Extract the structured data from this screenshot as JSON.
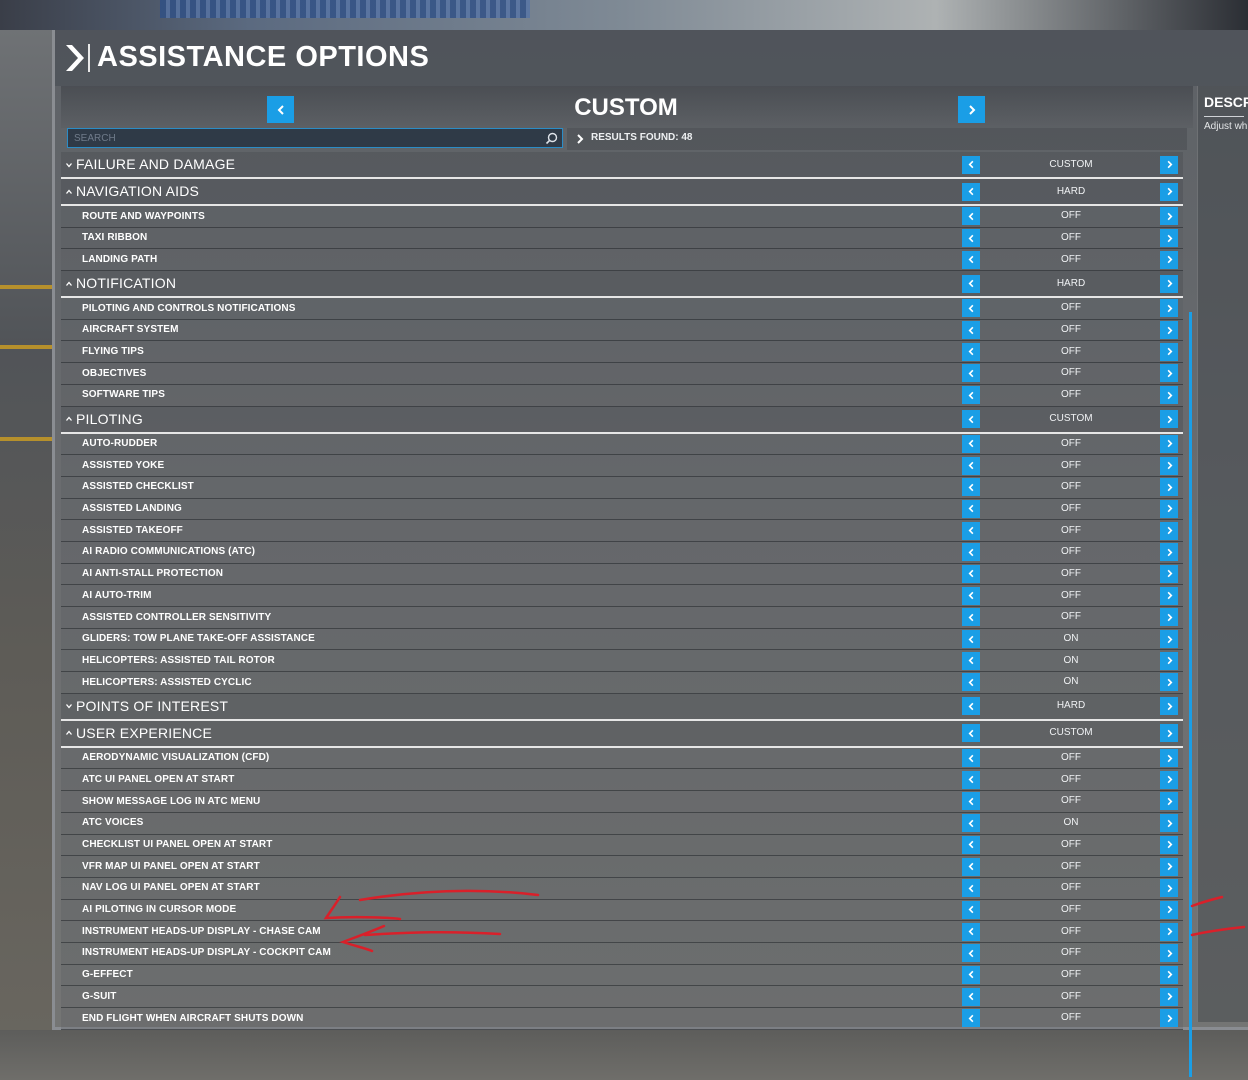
{
  "window": {
    "title": "ASSISTANCE OPTIONS"
  },
  "preset": {
    "label": "CUSTOM"
  },
  "search": {
    "placeholder": "SEARCH",
    "value": ""
  },
  "results": {
    "label": "RESULTS FOUND: 48"
  },
  "description": {
    "title": "DESCR",
    "text": "Adjust wh"
  },
  "colors": {
    "accent": "#1a9ee6",
    "annotation": "#d9202a"
  },
  "icons": {
    "header": "chevron-right-icon",
    "search": "magnifier-icon",
    "prev": "chevron-left-icon",
    "next": "chevron-right-icon",
    "expand": "caret-down-icon",
    "collapse": "caret-up-icon"
  },
  "rows": [
    {
      "kind": "cat",
      "expanded": false,
      "label": "FAILURE AND DAMAGE",
      "value": "CUSTOM"
    },
    {
      "kind": "cat",
      "expanded": true,
      "label": "NAVIGATION AIDS",
      "value": "HARD"
    },
    {
      "kind": "sub",
      "label": "ROUTE AND WAYPOINTS",
      "value": "OFF"
    },
    {
      "kind": "sub",
      "label": "TAXI RIBBON",
      "value": "OFF"
    },
    {
      "kind": "sub",
      "label": "LANDING PATH",
      "value": "OFF"
    },
    {
      "kind": "cat",
      "expanded": true,
      "label": "NOTIFICATION",
      "value": "HARD"
    },
    {
      "kind": "sub",
      "label": "PILOTING AND CONTROLS NOTIFICATIONS",
      "value": "OFF"
    },
    {
      "kind": "sub",
      "label": "AIRCRAFT SYSTEM",
      "value": "OFF"
    },
    {
      "kind": "sub",
      "label": "FLYING TIPS",
      "value": "OFF"
    },
    {
      "kind": "sub",
      "label": "OBJECTIVES",
      "value": "OFF"
    },
    {
      "kind": "sub",
      "label": "SOFTWARE TIPS",
      "value": "OFF"
    },
    {
      "kind": "cat",
      "expanded": true,
      "label": "PILOTING",
      "value": "CUSTOM"
    },
    {
      "kind": "sub",
      "label": "AUTO-RUDDER",
      "value": "OFF"
    },
    {
      "kind": "sub",
      "label": "ASSISTED YOKE",
      "value": "OFF"
    },
    {
      "kind": "sub",
      "label": "ASSISTED CHECKLIST",
      "value": "OFF"
    },
    {
      "kind": "sub",
      "label": "ASSISTED LANDING",
      "value": "OFF"
    },
    {
      "kind": "sub",
      "label": "ASSISTED TAKEOFF",
      "value": "OFF"
    },
    {
      "kind": "sub",
      "label": "AI RADIO COMMUNICATIONS (ATC)",
      "value": "OFF"
    },
    {
      "kind": "sub",
      "label": "AI ANTI-STALL PROTECTION",
      "value": "OFF"
    },
    {
      "kind": "sub",
      "label": "AI AUTO-TRIM",
      "value": "OFF"
    },
    {
      "kind": "sub",
      "label": "ASSISTED CONTROLLER SENSITIVITY",
      "value": "OFF"
    },
    {
      "kind": "sub",
      "label": "GLIDERS: TOW PLANE TAKE-OFF ASSISTANCE",
      "value": "ON"
    },
    {
      "kind": "sub",
      "label": "HELICOPTERS: ASSISTED TAIL ROTOR",
      "value": "ON"
    },
    {
      "kind": "sub",
      "label": "HELICOPTERS: ASSISTED CYCLIC",
      "value": "ON"
    },
    {
      "kind": "cat",
      "expanded": false,
      "label": "POINTS OF INTEREST",
      "value": "HARD"
    },
    {
      "kind": "cat",
      "expanded": true,
      "label": "USER EXPERIENCE",
      "value": "CUSTOM"
    },
    {
      "kind": "sub",
      "label": "AERODYNAMIC VISUALIZATION (CFD)",
      "value": "OFF"
    },
    {
      "kind": "sub",
      "label": "ATC UI PANEL OPEN AT START",
      "value": "OFF"
    },
    {
      "kind": "sub",
      "label": "SHOW MESSAGE LOG IN ATC MENU",
      "value": "OFF"
    },
    {
      "kind": "sub",
      "label": "ATC VOICES",
      "value": "ON"
    },
    {
      "kind": "sub",
      "label": "CHECKLIST UI PANEL OPEN AT START",
      "value": "OFF"
    },
    {
      "kind": "sub",
      "label": "VFR MAP UI PANEL OPEN AT START",
      "value": "OFF"
    },
    {
      "kind": "sub",
      "label": "NAV LOG UI PANEL OPEN AT START",
      "value": "OFF"
    },
    {
      "kind": "sub",
      "label": "AI PILOTING IN CURSOR MODE",
      "value": "OFF"
    },
    {
      "kind": "sub",
      "label": "INSTRUMENT HEADS-UP DISPLAY - CHASE CAM",
      "value": "OFF"
    },
    {
      "kind": "sub",
      "label": "INSTRUMENT HEADS-UP DISPLAY - COCKPIT CAM",
      "value": "OFF"
    },
    {
      "kind": "sub",
      "label": "G-EFFECT",
      "value": "OFF"
    },
    {
      "kind": "sub",
      "label": "G-SUIT",
      "value": "OFF"
    },
    {
      "kind": "sub",
      "label": "END FLIGHT WHEN AIRCRAFT SHUTS DOWN",
      "value": "OFF"
    }
  ]
}
